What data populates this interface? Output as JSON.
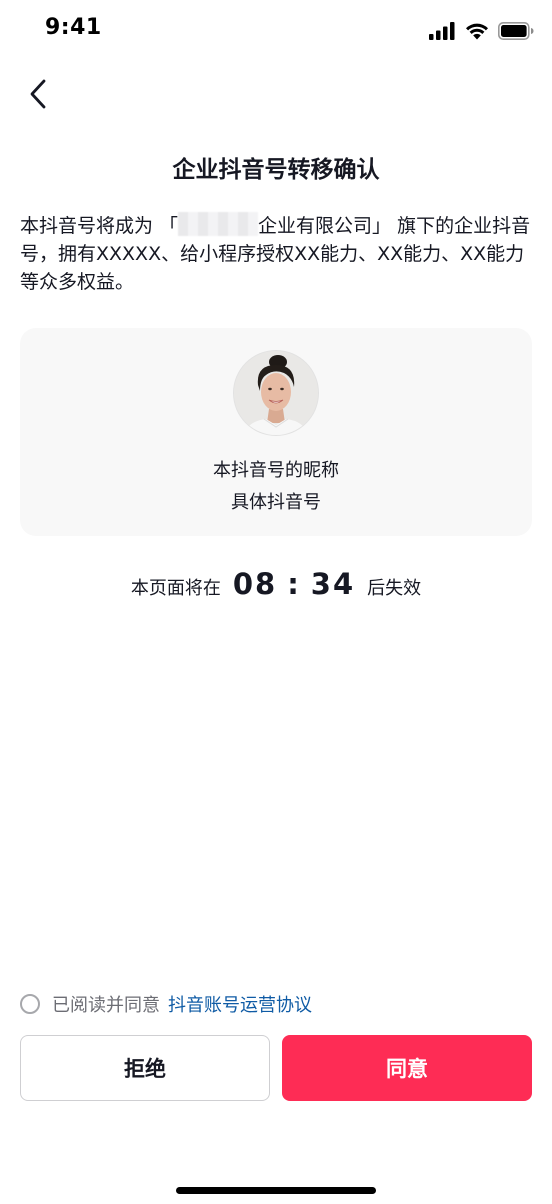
{
  "status_bar": {
    "time": "9:41",
    "icons": [
      "signal-icon",
      "wifi-icon",
      "battery-icon"
    ]
  },
  "header": {
    "back_icon": "chevron-left-icon",
    "title": "企业抖音号转移确认"
  },
  "description": {
    "part1": "本抖音号将成为 「",
    "company_suffix": "企业有限公司」 旗下的企业抖音号，拥有XXXXX、给小程序授权XX能力、XX能力、XX能力等众多权益。"
  },
  "account": {
    "nickname": "本抖音号的昵称",
    "account_id": "具体抖音号"
  },
  "countdown": {
    "prefix": "本页面将在",
    "minutes": "08",
    "separator": ":",
    "seconds": "34",
    "suffix": "后失效"
  },
  "agreement": {
    "text": "已阅读并同意",
    "link": "抖音账号运营协议",
    "checked": false
  },
  "buttons": {
    "reject_label": "拒绝",
    "accept_label": "同意"
  },
  "colors": {
    "accent": "#fe2c55",
    "link": "#0f5ba5",
    "text_primary": "#161823",
    "text_secondary": "#6c6d74",
    "card_bg": "#f8f8f8"
  }
}
